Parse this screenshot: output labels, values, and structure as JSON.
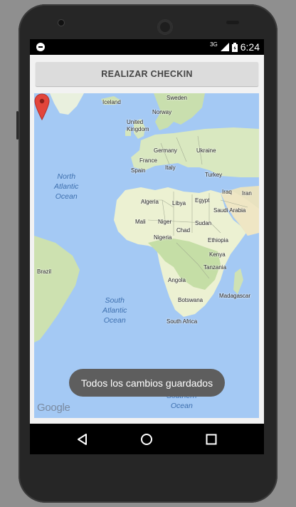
{
  "status_bar": {
    "time": "6:24",
    "network": "3G",
    "icons": [
      "notification-icon",
      "signal-icon",
      "battery-icon"
    ]
  },
  "app": {
    "checkin_button_label": "REALIZAR CHECKIN"
  },
  "map": {
    "ocean_labels": {
      "north_atlantic": "North\nAtlantic\nOcean",
      "south_atlantic": "South\nAtlantic\nOcean",
      "southern": "Southern\nOcean"
    },
    "countries": {
      "iceland": "Iceland",
      "sweden": "Sweden",
      "norway": "Norway",
      "united_kingdom": "United\nKingdom",
      "germany": "Germany",
      "ukraine": "Ukraine",
      "france": "France",
      "spain": "Spain",
      "italy": "Italy",
      "turkey": "Turkey",
      "algeria": "Algeria",
      "libya": "Libya",
      "egypt": "Egypt",
      "iraq": "Iraq",
      "iran": "Iran",
      "saudi_arabia": "Saudi Arabia",
      "mali": "Mali",
      "niger": "Niger",
      "chad": "Chad",
      "sudan": "Sudan",
      "nigeria": "Nigeria",
      "ethiopia": "Ethiopia",
      "kenya": "Kenya",
      "tanzania": "Tanzania",
      "angola": "Angola",
      "brazil": "Brazil",
      "madagascar": "Madagascar",
      "botswana": "Botswana",
      "south_africa": "South Africa"
    },
    "marker_color": "#e2453b",
    "attribution": "Google"
  },
  "toast": {
    "message": "Todos los cambios guardados"
  },
  "nav": {
    "icons": [
      "back-icon",
      "home-icon",
      "recents-icon"
    ]
  }
}
